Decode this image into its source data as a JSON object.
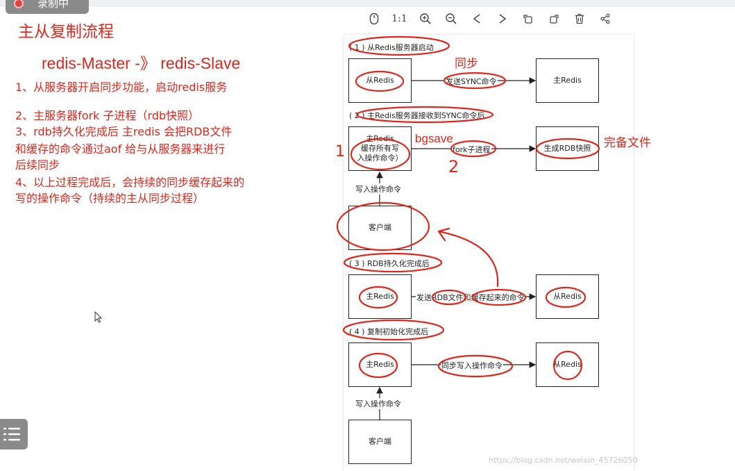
{
  "recording": {
    "label": "录制中"
  },
  "notes": {
    "title": "主从复制流程",
    "subtitle": "redis-Master -》  redis-Slave",
    "lines": [
      "1、从服务器开启同步功能，启动redis服务",
      "2、主服务器fork 子进程（rdb快照）",
      "3、rdb持久化完成后 主redis 会把RDB文件",
      "和缓存的命令通过aof 给与从服务器来进行",
      "后续同步",
      "4、以上过程完成后，会持续的同步缓存起来的",
      "写的操作命令（持续的主从同步过程）"
    ]
  },
  "toolbar": {
    "icons": [
      "mouse-icon",
      "actual-size-icon",
      "zoom-in-icon",
      "zoom-out-icon",
      "prev-icon",
      "next-icon",
      "rotate-left-icon",
      "rotate-right-icon",
      "delete-icon",
      "share-icon"
    ],
    "actual_size_label": "1:1"
  },
  "diagram": {
    "step1": {
      "label": "( 1 ) 从Redis服务器启动",
      "left_box": "从Redis",
      "right_box": "主Redis",
      "edge": "发送SYNC命令"
    },
    "step2": {
      "label": "( 2 ) 主Redis服务器接收到SYNC命令后",
      "left_box_line1": "主Redis",
      "left_box_line2": "缓存所有写",
      "left_box_line3": "入操作命令）",
      "right_box": "生成RDB快照",
      "edge": "fork子进程",
      "up_edge": "写入操作命令",
      "client_box": "客户端"
    },
    "step3": {
      "label": "( 3 ) RDB持久化完成后",
      "left_box": "主Redis",
      "right_box": "从Redis",
      "edge": "发送RDB文件和缓存起来的命令"
    },
    "step4": {
      "label": "( 4 ) 复制初始化完成后",
      "left_box": "主Redis",
      "right_box": "从Redis",
      "edge": "同步写入操作命令",
      "up_edge": "写入操作命令",
      "client_box": "客户端"
    }
  },
  "annotations": {
    "sync": "同步",
    "bgsave": "bgsave",
    "full_file": "完备文件",
    "num1": "1",
    "num2": "2"
  },
  "watermark": "https://blog.csdn.net/weixin_45726050",
  "colors": {
    "annotation": "#e0261b",
    "ink": "#222222"
  }
}
